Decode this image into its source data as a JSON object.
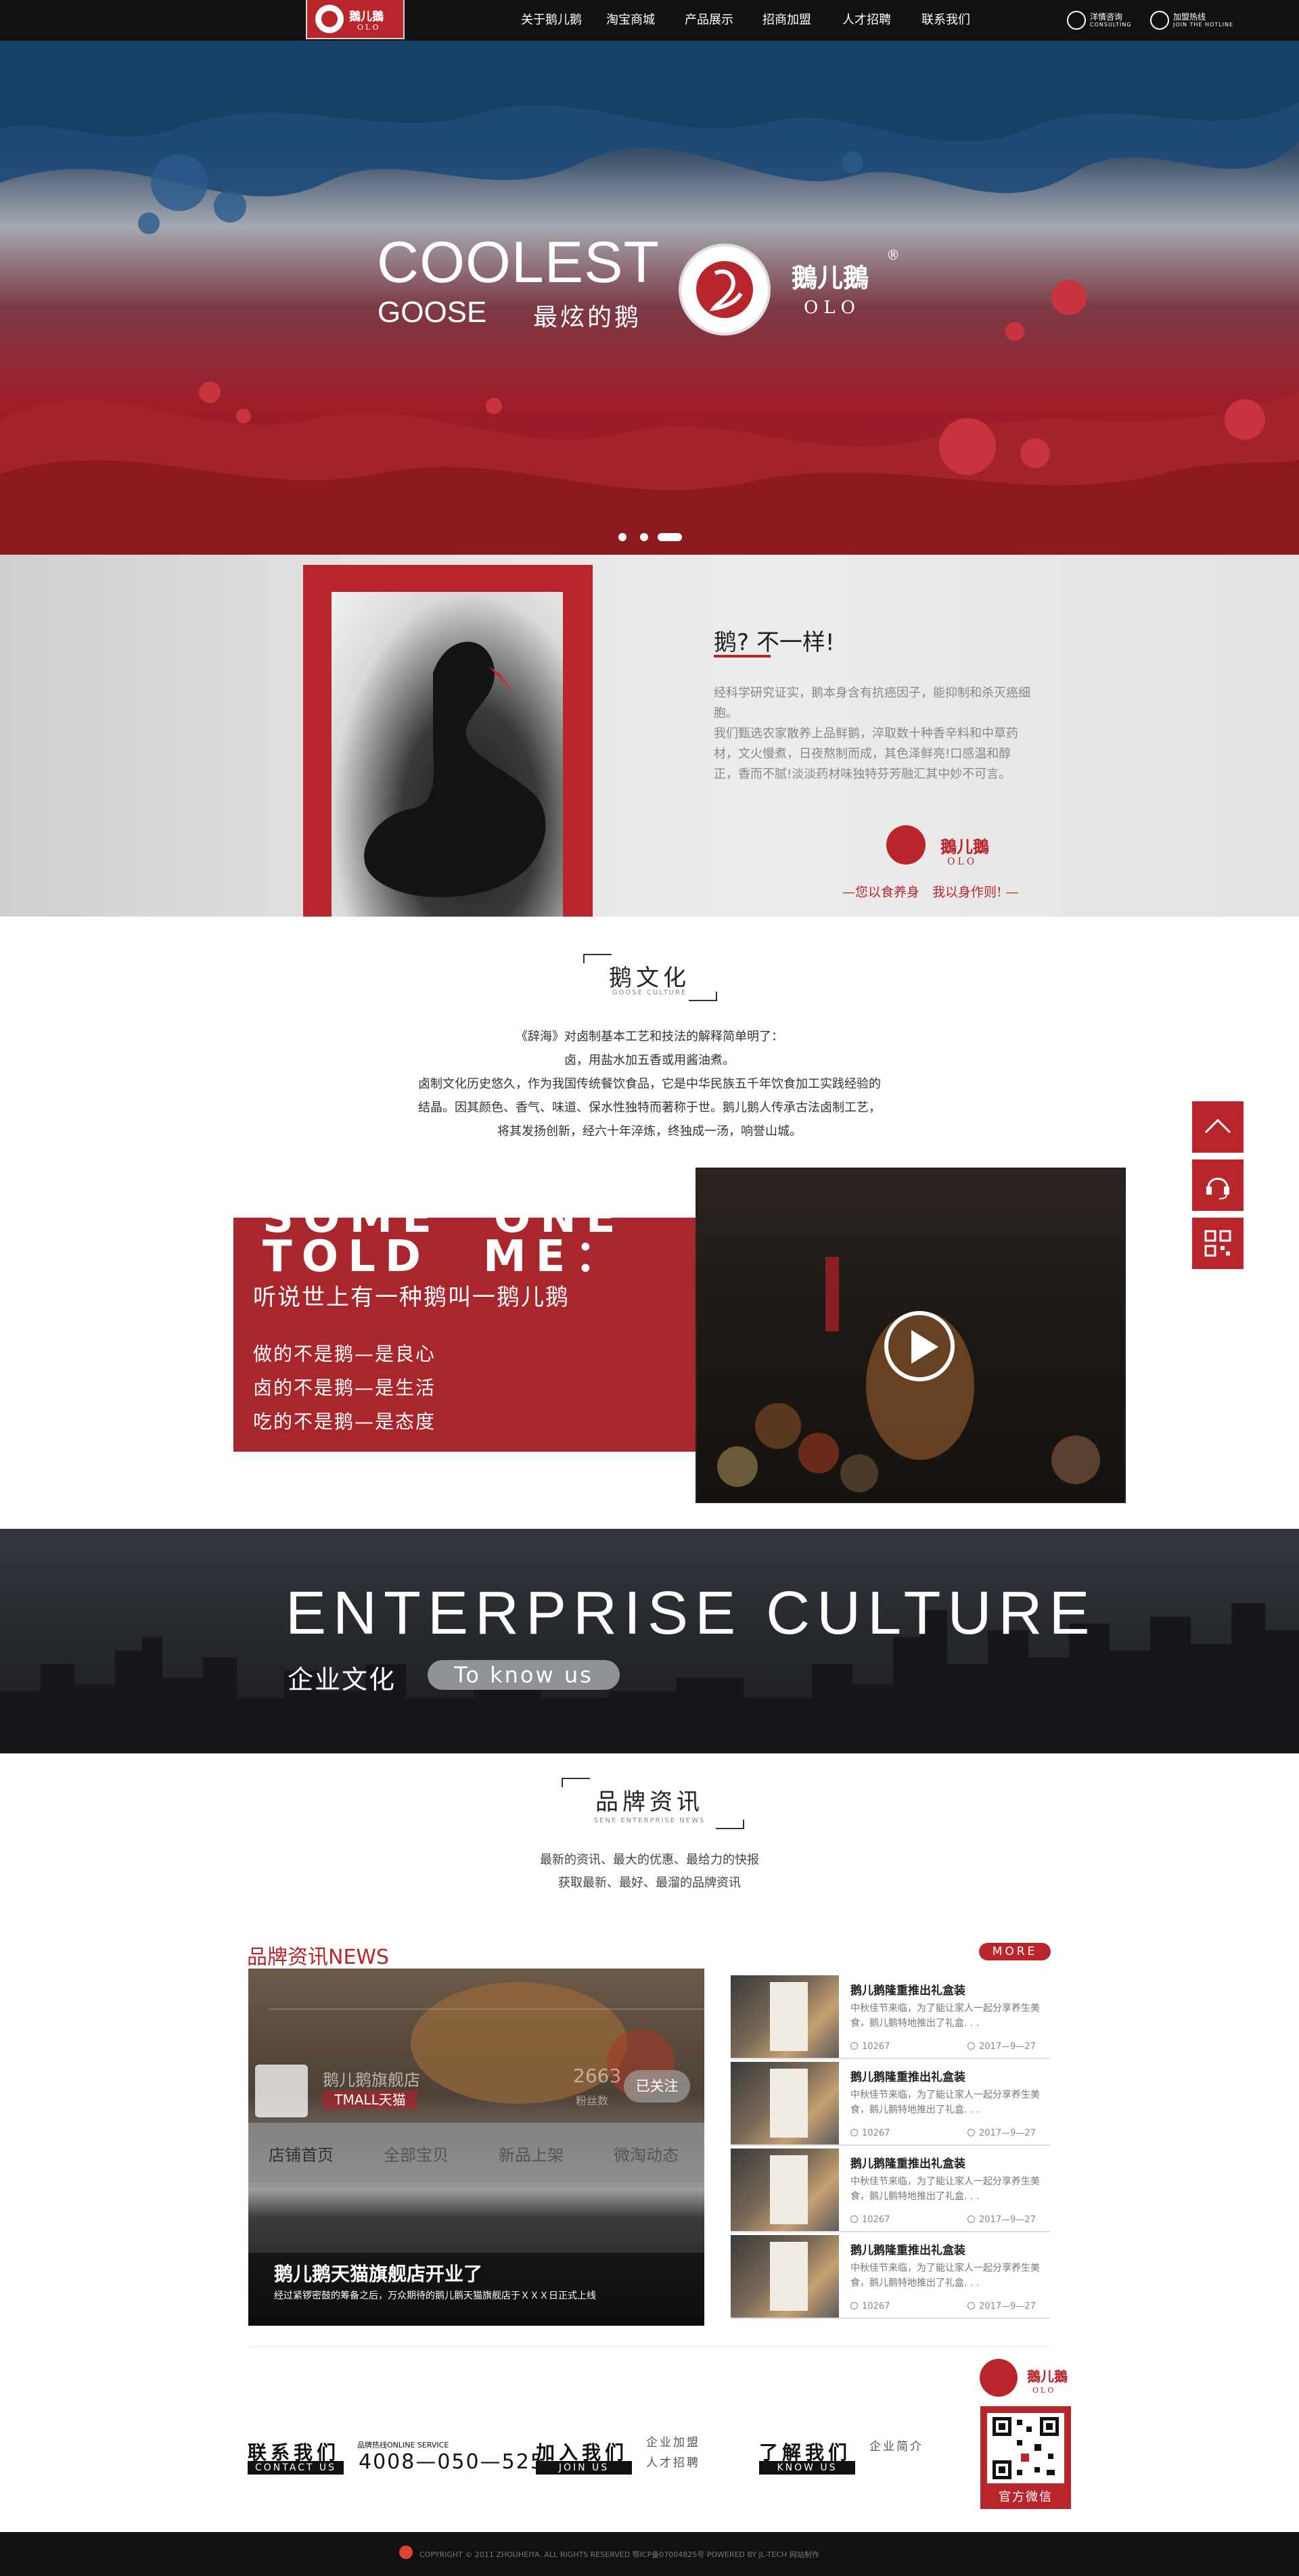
{
  "header": {
    "logo_cn": "鵝儿鵝",
    "logo_en": "OLO",
    "nav": [
      "关于鹅儿鹅",
      "淘宝商城",
      "产品展示",
      "招商加盟",
      "人才招聘",
      "联系我们"
    ],
    "consult_label": "洋情咨询",
    "consult_en": "CONSULTING",
    "hotline_label": "加盟热线",
    "hotline_en": "JOIN THE HOTLINE"
  },
  "hero": {
    "title1": "COOLEST",
    "title2": "GOOSE",
    "title3": "最炫的鹅",
    "brand_cn": "鵝儿鵝",
    "brand_en": "OLO",
    "reg": "®",
    "slides": 3,
    "active_slide": 3
  },
  "intro": {
    "title": "鹅? 不一样!",
    "paragraph1": "经科学研究证实，鹅本身含有抗癌因子，能抑制和杀灭癌细胞。",
    "paragraph2": "我们甄选农家散养上品鲜鹅，淬取数十种香辛料和中草药材，文火慢煮，日夜熬制而成，其色泽鲜亮!口感温和醇正，香而不腻!淡淡药材味独特芬芳融汇其中妙不可言。",
    "logo_cn": "鵝儿鵝",
    "logo_en": "OLO",
    "slogan": "—您以食养身　我以身作则! —"
  },
  "culture": {
    "title": "鹅文化",
    "subtitle": "GOOSE CULTURE",
    "lines": [
      "《辞海》对卤制基本工艺和技法的解释简单明了：",
      "卤，用盐水加五香或用酱油煮。",
      "卤制文化历史悠久，作为我国传统餐饮食品，它是中华民族五千年饮食加工实践经验的",
      "结晶。因其颜色、香气、味道、保水性独特而著称于世。鹅儿鹅人传承古法卤制工艺，",
      "将其发扬创新，经六十年淬炼，终独成一汤，响誉山城。"
    ],
    "story_big1": "SOME　ONE",
    "story_big2": "TOLD　ME：",
    "story_sub": "听说世上有一种鹅叫一鹅儿鹅",
    "story_lines": [
      "做的不是鹅—是良心",
      "卤的不是鹅—是生活",
      "吃的不是鹅—是态度"
    ]
  },
  "band": {
    "title": "ENTERPRISE CULTURE",
    "cn": "企业文化",
    "button": "To know us"
  },
  "news": {
    "title": "品牌资讯",
    "subtitle": "SENE ENTERPRISE NEWS",
    "intro1": "最新的资讯、最大的优惠、最给力的快报",
    "intro2": "获取最新、最好、最溜的品牌资讯",
    "label": "品牌资讯NEWS",
    "more": "MORE",
    "main": {
      "shop_name": "鹅儿鹅旗舰店",
      "shop_tmall": "TMALL天猫",
      "shop_stat": "2663",
      "shop_stat_label": "粉丝数",
      "follow": "已关注",
      "tabs": [
        "店铺首页",
        "全部宝贝",
        "新品上架",
        "微淘动态"
      ],
      "title": "鹅儿鹅天猫旗舰店开业了",
      "desc": "经过紧锣密鼓的筹备之后，万众期待的鹅儿鹅天猫旗舰店于ＸＸＸ日正式上线"
    },
    "items": [
      {
        "title": "鹅儿鹅隆重推出礼盒装",
        "desc": "中秋佳节来临，为了能让家人一起分享养生美食，鹅儿鹅特地推出了礼盒. . .",
        "views": "10267",
        "date": "2017—9—27"
      },
      {
        "title": "鹅儿鹅隆重推出礼盒装",
        "desc": "中秋佳节来临，为了能让家人一起分享养生美食，鹅儿鹅特地推出了礼盒. . .",
        "views": "10267",
        "date": "2017—9—27"
      },
      {
        "title": "鹅儿鹅隆重推出礼盒装",
        "desc": "中秋佳节来临，为了能让家人一起分享养生美食，鹅儿鹅特地推出了礼盒. . .",
        "views": "10267",
        "date": "2017—9—27"
      },
      {
        "title": "鹅儿鹅隆重推出礼盒装",
        "desc": "中秋佳节来临，为了能让家人一起分享养生美食，鹅儿鹅特地推出了礼盒. . .",
        "views": "10267",
        "date": "2017—9—27"
      }
    ]
  },
  "footer": {
    "contact_cn": "联系我们",
    "contact_en": "CONTACT US",
    "hotline_label": "品牌热线ONLINE SERVICE",
    "hotline": "4008—050—525",
    "join_cn": "加入我们",
    "join_en": "JOIN US",
    "join_link1": "企业加盟",
    "join_link2": "人才招聘",
    "know_cn": "了解我们",
    "know_en": "KNOW US",
    "know_link1": "企业简介",
    "qr_logo_cn": "鵝儿鵝",
    "qr_logo_en": "OLO",
    "qr_label": "官方微信",
    "copyright": "COPYRIGHT © 2011 ZHOUHEIYA. ALL RIGHTS RESERVED 鄂ICP备07004825号 POWERED BY JL-TECH 网站制作"
  },
  "colors": {
    "brand_red": "#b8252b",
    "header_bg": "#111111"
  }
}
